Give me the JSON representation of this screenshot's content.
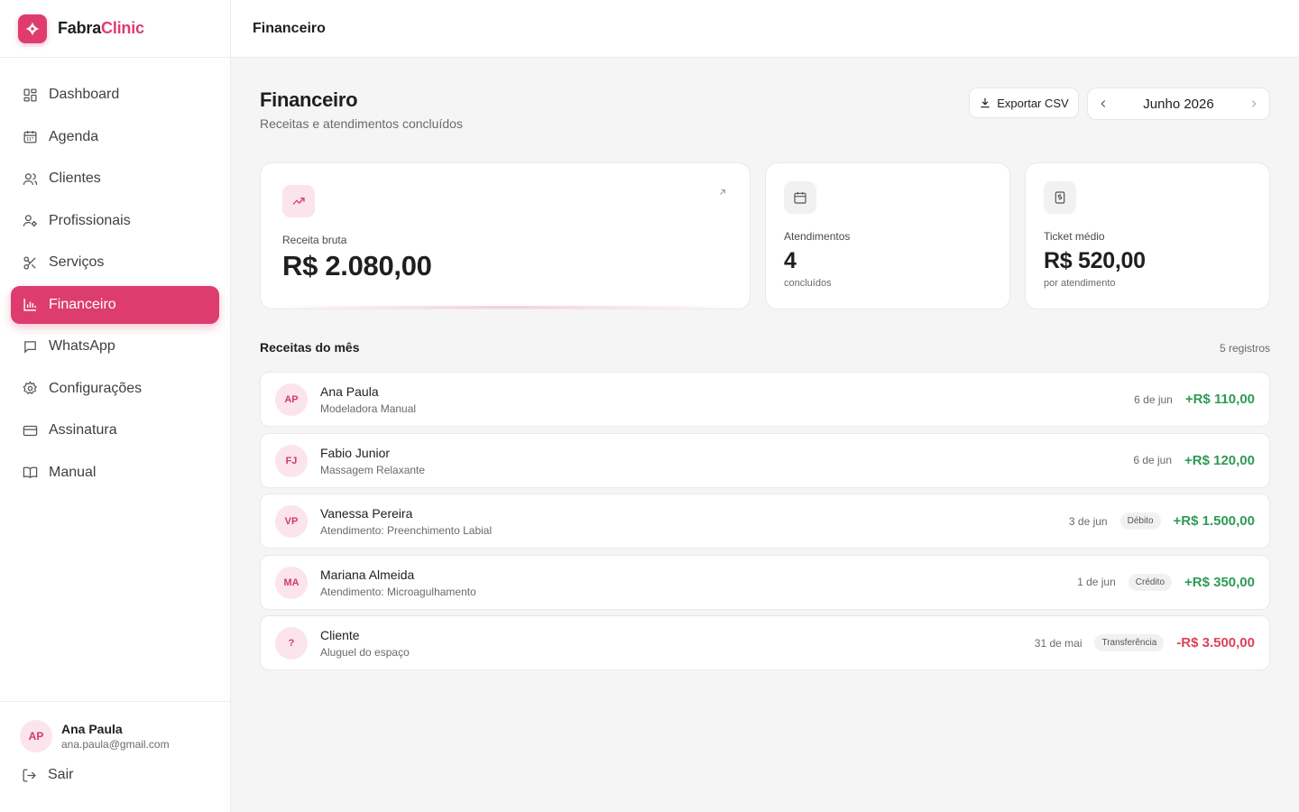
{
  "brand": {
    "name_part1": "Fabra",
    "name_part2": "Clinic",
    "accent_color": "#df3c6e"
  },
  "sidebar": {
    "items": [
      {
        "label": "Dashboard",
        "icon": "grid-icon",
        "active": false
      },
      {
        "label": "Agenda",
        "icon": "calendar-icon",
        "active": false
      },
      {
        "label": "Clientes",
        "icon": "users-icon",
        "active": false
      },
      {
        "label": "Profissionais",
        "icon": "user-cog-icon",
        "active": false
      },
      {
        "label": "Serviços",
        "icon": "scissors-icon",
        "active": false
      },
      {
        "label": "Financeiro",
        "icon": "bar-chart-icon",
        "active": true
      },
      {
        "label": "WhatsApp",
        "icon": "message-icon",
        "active": false
      },
      {
        "label": "Configurações",
        "icon": "gear-icon",
        "active": false
      },
      {
        "label": "Assinatura",
        "icon": "credit-card-icon",
        "active": false
      },
      {
        "label": "Manual",
        "icon": "book-icon",
        "active": false
      }
    ],
    "user": {
      "initials": "AP",
      "name": "Ana Paula",
      "email": "ana.paula@gmail.com"
    },
    "logout_label": "Sair"
  },
  "topbar": {
    "title": "Financeiro"
  },
  "header": {
    "title": "Financeiro",
    "subtitle": "Receitas e atendimentos concluídos",
    "export_label": "Exportar CSV",
    "month_label": "Junho 2026"
  },
  "stats": {
    "revenue": {
      "label": "Receita bruta",
      "value": "R$ 2.080,00",
      "icon": "trending-up-icon"
    },
    "appointments": {
      "label": "Atendimentos",
      "value": "4",
      "note": "concluídos",
      "icon": "calendar-icon"
    },
    "ticket": {
      "label": "Ticket médio",
      "value": "R$ 520,00",
      "note": "por atendimento",
      "icon": "dollar-receipt-icon"
    }
  },
  "records": {
    "title": "Receitas do mês",
    "count_label": "5 registros",
    "rows": [
      {
        "initials": "AP",
        "name": "Ana Paula",
        "desc": "Modeladora Manual",
        "date": "6 de jun",
        "badge": "",
        "amount": "+R$ 110,00",
        "type": "pos"
      },
      {
        "initials": "FJ",
        "name": "Fabio Junior",
        "desc": "Massagem Relaxante",
        "date": "6 de jun",
        "badge": "",
        "amount": "+R$ 120,00",
        "type": "pos"
      },
      {
        "initials": "VP",
        "name": "Vanessa Pereira",
        "desc": "Atendimento: Preenchimento Labial",
        "date": "3 de jun",
        "badge": "Débito",
        "amount": "+R$ 1.500,00",
        "type": "pos"
      },
      {
        "initials": "MA",
        "name": "Mariana Almeida",
        "desc": "Atendimento: Microagulhamento",
        "date": "1 de jun",
        "badge": "Crédito",
        "amount": "+R$ 350,00",
        "type": "pos"
      },
      {
        "initials": "?",
        "name": "Cliente",
        "desc": "Aluguel do espaço",
        "date": "31 de mai",
        "badge": "Transferência",
        "amount": "-R$ 3.500,00",
        "type": "neg"
      }
    ]
  },
  "colors": {
    "positive": "#2e9b55",
    "negative": "#e0405a",
    "active_nav": "#dd3d6e"
  }
}
